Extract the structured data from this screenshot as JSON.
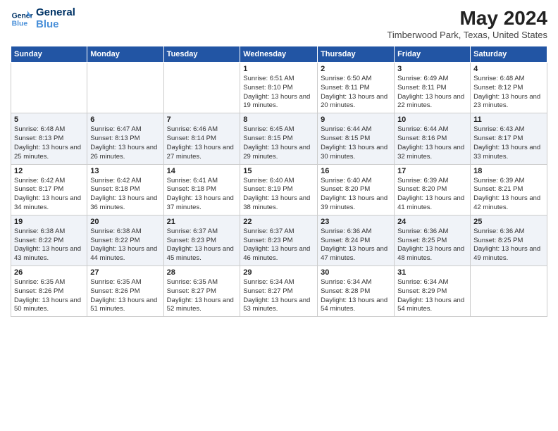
{
  "logo": {
    "line1": "General",
    "line2": "Blue"
  },
  "title": "May 2024",
  "location": "Timberwood Park, Texas, United States",
  "days_of_week": [
    "Sunday",
    "Monday",
    "Tuesday",
    "Wednesday",
    "Thursday",
    "Friday",
    "Saturday"
  ],
  "weeks": [
    [
      {
        "day": "",
        "info": ""
      },
      {
        "day": "",
        "info": ""
      },
      {
        "day": "",
        "info": ""
      },
      {
        "day": "1",
        "info": "Sunrise: 6:51 AM\nSunset: 8:10 PM\nDaylight: 13 hours and 19 minutes."
      },
      {
        "day": "2",
        "info": "Sunrise: 6:50 AM\nSunset: 8:11 PM\nDaylight: 13 hours and 20 minutes."
      },
      {
        "day": "3",
        "info": "Sunrise: 6:49 AM\nSunset: 8:11 PM\nDaylight: 13 hours and 22 minutes."
      },
      {
        "day": "4",
        "info": "Sunrise: 6:48 AM\nSunset: 8:12 PM\nDaylight: 13 hours and 23 minutes."
      }
    ],
    [
      {
        "day": "5",
        "info": "Sunrise: 6:48 AM\nSunset: 8:13 PM\nDaylight: 13 hours and 25 minutes."
      },
      {
        "day": "6",
        "info": "Sunrise: 6:47 AM\nSunset: 8:13 PM\nDaylight: 13 hours and 26 minutes."
      },
      {
        "day": "7",
        "info": "Sunrise: 6:46 AM\nSunset: 8:14 PM\nDaylight: 13 hours and 27 minutes."
      },
      {
        "day": "8",
        "info": "Sunrise: 6:45 AM\nSunset: 8:15 PM\nDaylight: 13 hours and 29 minutes."
      },
      {
        "day": "9",
        "info": "Sunrise: 6:44 AM\nSunset: 8:15 PM\nDaylight: 13 hours and 30 minutes."
      },
      {
        "day": "10",
        "info": "Sunrise: 6:44 AM\nSunset: 8:16 PM\nDaylight: 13 hours and 32 minutes."
      },
      {
        "day": "11",
        "info": "Sunrise: 6:43 AM\nSunset: 8:17 PM\nDaylight: 13 hours and 33 minutes."
      }
    ],
    [
      {
        "day": "12",
        "info": "Sunrise: 6:42 AM\nSunset: 8:17 PM\nDaylight: 13 hours and 34 minutes."
      },
      {
        "day": "13",
        "info": "Sunrise: 6:42 AM\nSunset: 8:18 PM\nDaylight: 13 hours and 36 minutes."
      },
      {
        "day": "14",
        "info": "Sunrise: 6:41 AM\nSunset: 8:18 PM\nDaylight: 13 hours and 37 minutes."
      },
      {
        "day": "15",
        "info": "Sunrise: 6:40 AM\nSunset: 8:19 PM\nDaylight: 13 hours and 38 minutes."
      },
      {
        "day": "16",
        "info": "Sunrise: 6:40 AM\nSunset: 8:20 PM\nDaylight: 13 hours and 39 minutes."
      },
      {
        "day": "17",
        "info": "Sunrise: 6:39 AM\nSunset: 8:20 PM\nDaylight: 13 hours and 41 minutes."
      },
      {
        "day": "18",
        "info": "Sunrise: 6:39 AM\nSunset: 8:21 PM\nDaylight: 13 hours and 42 minutes."
      }
    ],
    [
      {
        "day": "19",
        "info": "Sunrise: 6:38 AM\nSunset: 8:22 PM\nDaylight: 13 hours and 43 minutes."
      },
      {
        "day": "20",
        "info": "Sunrise: 6:38 AM\nSunset: 8:22 PM\nDaylight: 13 hours and 44 minutes."
      },
      {
        "day": "21",
        "info": "Sunrise: 6:37 AM\nSunset: 8:23 PM\nDaylight: 13 hours and 45 minutes."
      },
      {
        "day": "22",
        "info": "Sunrise: 6:37 AM\nSunset: 8:23 PM\nDaylight: 13 hours and 46 minutes."
      },
      {
        "day": "23",
        "info": "Sunrise: 6:36 AM\nSunset: 8:24 PM\nDaylight: 13 hours and 47 minutes."
      },
      {
        "day": "24",
        "info": "Sunrise: 6:36 AM\nSunset: 8:25 PM\nDaylight: 13 hours and 48 minutes."
      },
      {
        "day": "25",
        "info": "Sunrise: 6:36 AM\nSunset: 8:25 PM\nDaylight: 13 hours and 49 minutes."
      }
    ],
    [
      {
        "day": "26",
        "info": "Sunrise: 6:35 AM\nSunset: 8:26 PM\nDaylight: 13 hours and 50 minutes."
      },
      {
        "day": "27",
        "info": "Sunrise: 6:35 AM\nSunset: 8:26 PM\nDaylight: 13 hours and 51 minutes."
      },
      {
        "day": "28",
        "info": "Sunrise: 6:35 AM\nSunset: 8:27 PM\nDaylight: 13 hours and 52 minutes."
      },
      {
        "day": "29",
        "info": "Sunrise: 6:34 AM\nSunset: 8:27 PM\nDaylight: 13 hours and 53 minutes."
      },
      {
        "day": "30",
        "info": "Sunrise: 6:34 AM\nSunset: 8:28 PM\nDaylight: 13 hours and 54 minutes."
      },
      {
        "day": "31",
        "info": "Sunrise: 6:34 AM\nSunset: 8:29 PM\nDaylight: 13 hours and 54 minutes."
      },
      {
        "day": "",
        "info": ""
      }
    ]
  ]
}
